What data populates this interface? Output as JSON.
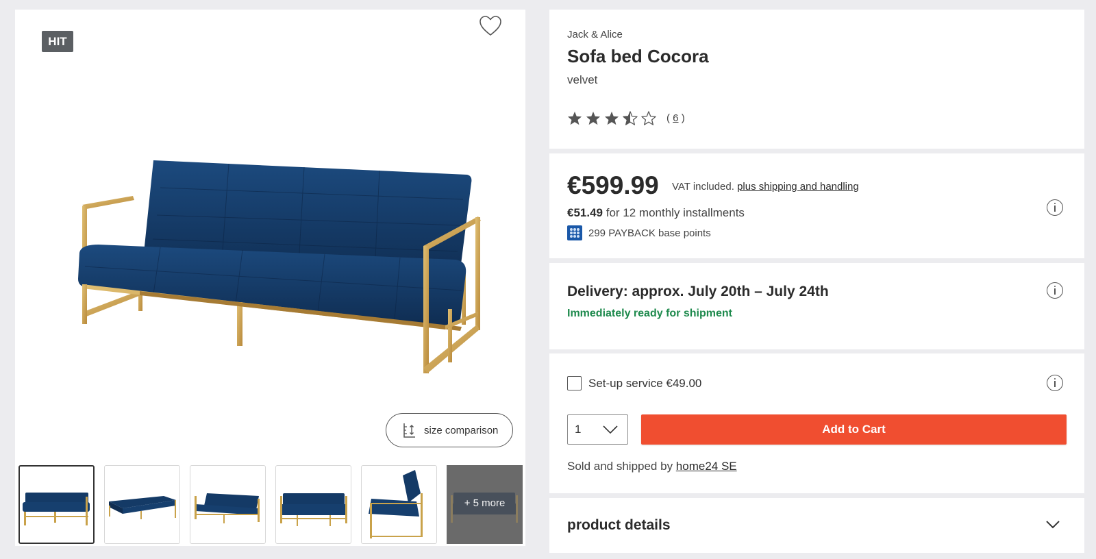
{
  "gallery": {
    "badge": "HIT",
    "size_comparison_label": "size comparison",
    "more_label": "+ 5 more",
    "thumbnails": [
      {
        "icon": "sofa-front-thumbnail",
        "active": true
      },
      {
        "icon": "sofa-flat-thumbnail",
        "active": false
      },
      {
        "icon": "sofa-angle-thumbnail",
        "active": false
      },
      {
        "icon": "sofa-front-thumbnail",
        "active": false
      },
      {
        "icon": "sofa-side-thumbnail",
        "active": false
      }
    ]
  },
  "product": {
    "brand": "Jack & Alice",
    "name": "Sofa bed Cocora",
    "variant": "velvet",
    "rating": 3.5,
    "rating_max": 5,
    "rating_count_open": "(",
    "rating_count": "6",
    "rating_count_close": ")"
  },
  "price": {
    "amount": "€599.99",
    "vat": "VAT included.",
    "shipping_link": "plus shipping and handling",
    "installment_amount": "€51.49",
    "installment_text": "for 12 monthly installments",
    "payback": "299 PAYBACK base points"
  },
  "delivery": {
    "title": "Delivery: approx. July 20th – July 24th",
    "status": "Immediately ready for shipment"
  },
  "cart": {
    "setup_service": "Set-up service €49.00",
    "quantity": "1",
    "add_to_cart": "Add to Cart",
    "sold_by_prefix": "Sold and shipped by",
    "seller": "home24 SE"
  },
  "details": {
    "title": "product details"
  },
  "colors": {
    "accent": "#f04e30",
    "success": "#1e8a4d",
    "sofa": "#143a66",
    "frame": "#c9a24a"
  }
}
